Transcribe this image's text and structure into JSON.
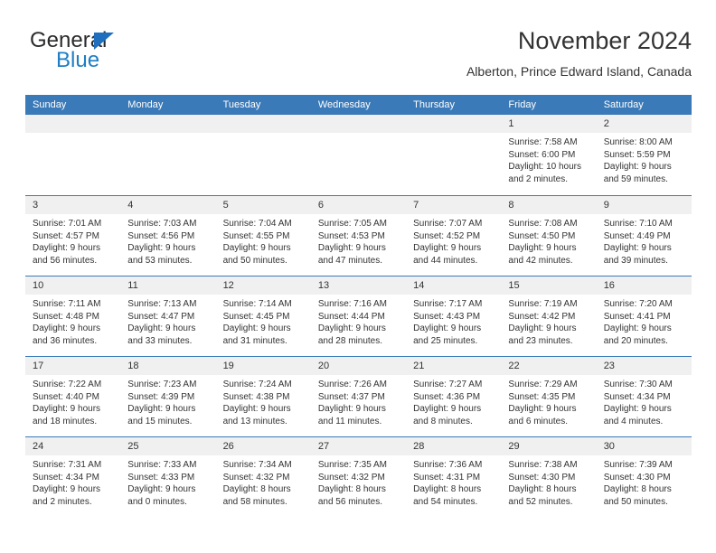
{
  "brand": {
    "name_top": "General",
    "name_bottom": "Blue",
    "triangle_color": "#1f6fbf",
    "blue_text_color": "#1f7ec4"
  },
  "header": {
    "title": "November 2024",
    "subtitle": "Alberton, Prince Edward Island, Canada"
  },
  "theme": {
    "header_blue": "#3b7ab8",
    "day_band_gray": "#f0f0f0",
    "text_color": "#333333"
  },
  "weekdays": [
    "Sunday",
    "Monday",
    "Tuesday",
    "Wednesday",
    "Thursday",
    "Friday",
    "Saturday"
  ],
  "labels": {
    "sunrise_prefix": "Sunrise: ",
    "sunset_prefix": "Sunset: ",
    "daylight_prefix": "Daylight: "
  },
  "weeks": [
    [
      {
        "day": "",
        "sunrise": "",
        "sunset": "",
        "daylight": "",
        "empty": true
      },
      {
        "day": "",
        "sunrise": "",
        "sunset": "",
        "daylight": "",
        "empty": true
      },
      {
        "day": "",
        "sunrise": "",
        "sunset": "",
        "daylight": "",
        "empty": true
      },
      {
        "day": "",
        "sunrise": "",
        "sunset": "",
        "daylight": "",
        "empty": true
      },
      {
        "day": "",
        "sunrise": "",
        "sunset": "",
        "daylight": "",
        "empty": true
      },
      {
        "day": "1",
        "sunrise": "Sunrise: 7:58 AM",
        "sunset": "Sunset: 6:00 PM",
        "daylight": "Daylight: 10 hours and 2 minutes.",
        "empty": false
      },
      {
        "day": "2",
        "sunrise": "Sunrise: 8:00 AM",
        "sunset": "Sunset: 5:59 PM",
        "daylight": "Daylight: 9 hours and 59 minutes.",
        "empty": false
      }
    ],
    [
      {
        "day": "3",
        "sunrise": "Sunrise: 7:01 AM",
        "sunset": "Sunset: 4:57 PM",
        "daylight": "Daylight: 9 hours and 56 minutes.",
        "empty": false
      },
      {
        "day": "4",
        "sunrise": "Sunrise: 7:03 AM",
        "sunset": "Sunset: 4:56 PM",
        "daylight": "Daylight: 9 hours and 53 minutes.",
        "empty": false
      },
      {
        "day": "5",
        "sunrise": "Sunrise: 7:04 AM",
        "sunset": "Sunset: 4:55 PM",
        "daylight": "Daylight: 9 hours and 50 minutes.",
        "empty": false
      },
      {
        "day": "6",
        "sunrise": "Sunrise: 7:05 AM",
        "sunset": "Sunset: 4:53 PM",
        "daylight": "Daylight: 9 hours and 47 minutes.",
        "empty": false
      },
      {
        "day": "7",
        "sunrise": "Sunrise: 7:07 AM",
        "sunset": "Sunset: 4:52 PM",
        "daylight": "Daylight: 9 hours and 44 minutes.",
        "empty": false
      },
      {
        "day": "8",
        "sunrise": "Sunrise: 7:08 AM",
        "sunset": "Sunset: 4:50 PM",
        "daylight": "Daylight: 9 hours and 42 minutes.",
        "empty": false
      },
      {
        "day": "9",
        "sunrise": "Sunrise: 7:10 AM",
        "sunset": "Sunset: 4:49 PM",
        "daylight": "Daylight: 9 hours and 39 minutes.",
        "empty": false
      }
    ],
    [
      {
        "day": "10",
        "sunrise": "Sunrise: 7:11 AM",
        "sunset": "Sunset: 4:48 PM",
        "daylight": "Daylight: 9 hours and 36 minutes.",
        "empty": false
      },
      {
        "day": "11",
        "sunrise": "Sunrise: 7:13 AM",
        "sunset": "Sunset: 4:47 PM",
        "daylight": "Daylight: 9 hours and 33 minutes.",
        "empty": false
      },
      {
        "day": "12",
        "sunrise": "Sunrise: 7:14 AM",
        "sunset": "Sunset: 4:45 PM",
        "daylight": "Daylight: 9 hours and 31 minutes.",
        "empty": false
      },
      {
        "day": "13",
        "sunrise": "Sunrise: 7:16 AM",
        "sunset": "Sunset: 4:44 PM",
        "daylight": "Daylight: 9 hours and 28 minutes.",
        "empty": false
      },
      {
        "day": "14",
        "sunrise": "Sunrise: 7:17 AM",
        "sunset": "Sunset: 4:43 PM",
        "daylight": "Daylight: 9 hours and 25 minutes.",
        "empty": false
      },
      {
        "day": "15",
        "sunrise": "Sunrise: 7:19 AM",
        "sunset": "Sunset: 4:42 PM",
        "daylight": "Daylight: 9 hours and 23 minutes.",
        "empty": false
      },
      {
        "day": "16",
        "sunrise": "Sunrise: 7:20 AM",
        "sunset": "Sunset: 4:41 PM",
        "daylight": "Daylight: 9 hours and 20 minutes.",
        "empty": false
      }
    ],
    [
      {
        "day": "17",
        "sunrise": "Sunrise: 7:22 AM",
        "sunset": "Sunset: 4:40 PM",
        "daylight": "Daylight: 9 hours and 18 minutes.",
        "empty": false
      },
      {
        "day": "18",
        "sunrise": "Sunrise: 7:23 AM",
        "sunset": "Sunset: 4:39 PM",
        "daylight": "Daylight: 9 hours and 15 minutes.",
        "empty": false
      },
      {
        "day": "19",
        "sunrise": "Sunrise: 7:24 AM",
        "sunset": "Sunset: 4:38 PM",
        "daylight": "Daylight: 9 hours and 13 minutes.",
        "empty": false
      },
      {
        "day": "20",
        "sunrise": "Sunrise: 7:26 AM",
        "sunset": "Sunset: 4:37 PM",
        "daylight": "Daylight: 9 hours and 11 minutes.",
        "empty": false
      },
      {
        "day": "21",
        "sunrise": "Sunrise: 7:27 AM",
        "sunset": "Sunset: 4:36 PM",
        "daylight": "Daylight: 9 hours and 8 minutes.",
        "empty": false
      },
      {
        "day": "22",
        "sunrise": "Sunrise: 7:29 AM",
        "sunset": "Sunset: 4:35 PM",
        "daylight": "Daylight: 9 hours and 6 minutes.",
        "empty": false
      },
      {
        "day": "23",
        "sunrise": "Sunrise: 7:30 AM",
        "sunset": "Sunset: 4:34 PM",
        "daylight": "Daylight: 9 hours and 4 minutes.",
        "empty": false
      }
    ],
    [
      {
        "day": "24",
        "sunrise": "Sunrise: 7:31 AM",
        "sunset": "Sunset: 4:34 PM",
        "daylight": "Daylight: 9 hours and 2 minutes.",
        "empty": false
      },
      {
        "day": "25",
        "sunrise": "Sunrise: 7:33 AM",
        "sunset": "Sunset: 4:33 PM",
        "daylight": "Daylight: 9 hours and 0 minutes.",
        "empty": false
      },
      {
        "day": "26",
        "sunrise": "Sunrise: 7:34 AM",
        "sunset": "Sunset: 4:32 PM",
        "daylight": "Daylight: 8 hours and 58 minutes.",
        "empty": false
      },
      {
        "day": "27",
        "sunrise": "Sunrise: 7:35 AM",
        "sunset": "Sunset: 4:32 PM",
        "daylight": "Daylight: 8 hours and 56 minutes.",
        "empty": false
      },
      {
        "day": "28",
        "sunrise": "Sunrise: 7:36 AM",
        "sunset": "Sunset: 4:31 PM",
        "daylight": "Daylight: 8 hours and 54 minutes.",
        "empty": false
      },
      {
        "day": "29",
        "sunrise": "Sunrise: 7:38 AM",
        "sunset": "Sunset: 4:30 PM",
        "daylight": "Daylight: 8 hours and 52 minutes.",
        "empty": false
      },
      {
        "day": "30",
        "sunrise": "Sunrise: 7:39 AM",
        "sunset": "Sunset: 4:30 PM",
        "daylight": "Daylight: 8 hours and 50 minutes.",
        "empty": false
      }
    ]
  ]
}
